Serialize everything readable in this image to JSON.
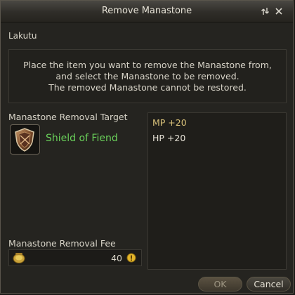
{
  "window": {
    "title": "Remove Manastone"
  },
  "npc_name": "Lakutu",
  "info": {
    "line1": "Place the item you want to remove the Manastone from,",
    "line2": "and select the Manastone to be removed.",
    "line3": "The removed Manastone cannot be restored."
  },
  "target": {
    "label": "Manastone Removal Target",
    "item_name": "Shield of Fiend",
    "item_icon": "shield-icon",
    "item_color": "#6ad05a"
  },
  "manastones": [
    {
      "text": "MP +20",
      "color": "#d9c27a"
    },
    {
      "text": "HP +20",
      "color": "#e6e2d6"
    }
  ],
  "fee": {
    "label": "Manastone Removal Fee",
    "amount": "40",
    "icon": "kinah-coin-icon"
  },
  "buttons": {
    "ok": "OK",
    "cancel": "Cancel"
  }
}
